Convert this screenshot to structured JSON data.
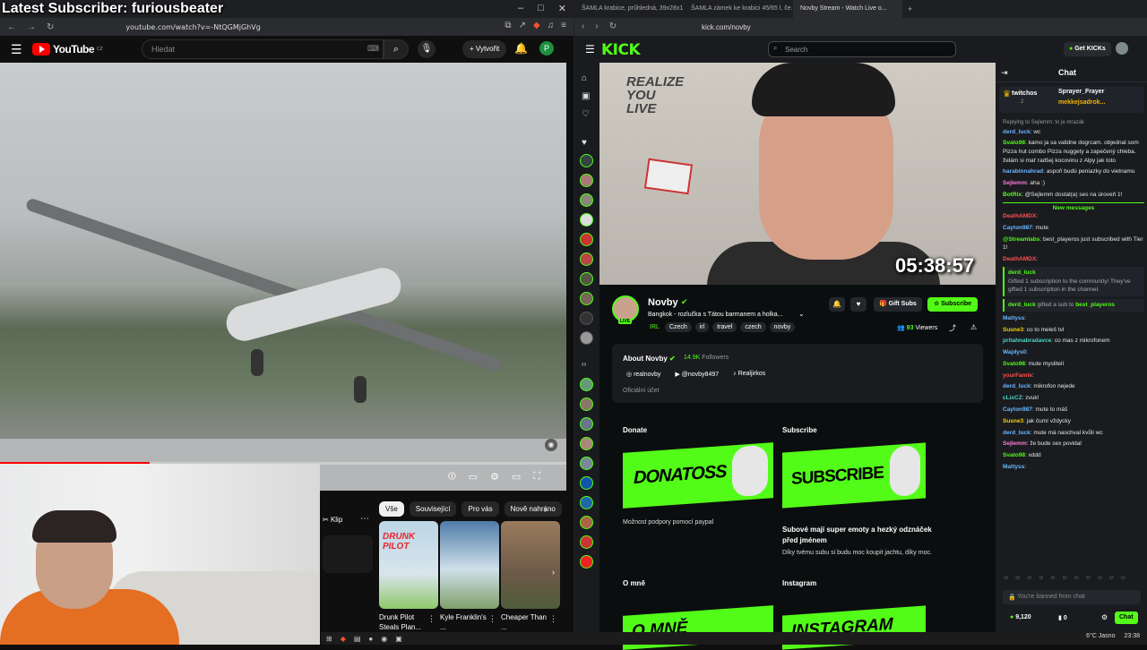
{
  "overlay": {
    "title": "Latest Subscriber: furiousbeater"
  },
  "left_browser": {
    "url": "youtube.com/watch?v=-NtQGMjGhVg",
    "youtube": {
      "logo_text": "YouTube",
      "country": "CZ",
      "search_placeholder": "Hledat",
      "create_label": "Vytvořit",
      "avatar_letter": "P",
      "clip_label": "Klip",
      "chips": [
        "Vše",
        "Související",
        "Pro vás",
        "Nově nahráno"
      ],
      "progress_fraction": 0.265,
      "videos": [
        {
          "title": "Drunk Pilot Steals Plan...",
          "thumb_text": "DRUNK PILOT"
        },
        {
          "title": "Kyle Franklin's ...",
          "thumb_text": ""
        },
        {
          "title": "Cheaper Than ...",
          "thumb_text": ""
        }
      ]
    }
  },
  "right_browser": {
    "tabs": [
      "ŠAMLA krabice, průhledná, 39x28x1...",
      "ŠAMLA zámek ke krabici 45/65 l, če...",
      "Novby Stream - Watch Live o..."
    ],
    "url": "kick.com/novby",
    "kick": {
      "logo": "KICK",
      "search_placeholder": "Search",
      "get_kicks": "Get KICKs",
      "timer": "05:38:57",
      "wall_text": "REALIZE\nYOU\nLIVE",
      "channel": {
        "name": "Novby",
        "live_badge": "LIVE",
        "title": "Bangkok - rozlučka s Tátou barmanem a holka...",
        "category": "IRL",
        "tags": [
          "Czech",
          "irl",
          "travel",
          "czech",
          "novby"
        ],
        "gift_subs": "Gift Subs",
        "subscribe": "Subscribe",
        "viewers_count": "93",
        "viewers_label": "Viewers"
      },
      "about": {
        "title": "About Novby",
        "followers_count": "14.9K",
        "followers_label": "Followers",
        "socials": [
          "realnovby",
          "@novby8497",
          "Realjirkos"
        ],
        "official": "Oficiální účet"
      },
      "panels": {
        "donate_title": "Donate",
        "donate_banner": "DONATOSS",
        "donate_desc": "Možnost podpory pomocí paypal",
        "subscribe_title": "Subscribe",
        "subscribe_banner": "SUBSCRIBE",
        "subscribe_desc1": "Subové mají super emoty a hezký odznáček před jménem",
        "subscribe_desc2": "Díky tvému subu si budu moc koupit jachtu, díky moc.",
        "omne_title": "O mně",
        "omne_banner": "O MNĚ",
        "instagram_title": "Instagram",
        "instagram_banner": "INSTAGRAM"
      },
      "chat": {
        "title": "Chat",
        "pinned_left": "twitchos",
        "pinned_num": "2",
        "pinned_r1": "Sprayer_Frayer",
        "pinned_r2": "mekkejsadrok...",
        "reply_note": "Replying to Sejlemm: to je mrazák",
        "new_messages": "New messages",
        "input_placeholder": "You're banned from chat",
        "kicks_balance": "9,120",
        "points": "0",
        "send": "Chat",
        "messages": [
          {
            "user": "derd_luck",
            "text": "wc",
            "color": "blue"
          },
          {
            "user": "Svato98",
            "text": "kamo ja sa validne dogrcam. objednal som Pizza hut combo Pizza nuggety a zapečený chleba. želám si mať radšej kocovinu z Alpy jak toto",
            "color": "green"
          },
          {
            "user": "harabinnahrad",
            "text": "aspoň budú peniazky do vietnamu",
            "color": "blue"
          },
          {
            "user": "Sejlemm",
            "text": "aha :)",
            "color": "pink"
          },
          {
            "user": "BotRix",
            "text": "@Sejlemm dostal(a) ses na úroveň 1!",
            "color": "green"
          }
        ],
        "messages_after": [
          {
            "user": "DeathAMDX",
            "text": "",
            "color": "red"
          },
          {
            "user": "Cayton987",
            "text": "mute",
            "color": "blue"
          },
          {
            "user": "@Streamlabs",
            "text": "best_playeros just subscribed with Tier 1!",
            "color": "green"
          },
          {
            "user": "DeathAMDX",
            "text": "",
            "color": "red"
          }
        ],
        "sys1_user": "derd_luck",
        "sys1_text": "Gifted 1 subscription to the community! They've gifted 1 subscription in the channel.",
        "sys2_user": "derd_luck",
        "sys2_text": "gifted a sub to",
        "sys2_target": "best_playeros",
        "messages_end": [
          {
            "user": "Mattyss",
            "text": "",
            "color": "blue"
          },
          {
            "user": "Susne3",
            "text": "co to meleš tvl",
            "color": "yellow"
          },
          {
            "user": "pritahnabradavce",
            "text": "co mas z mikrofonem",
            "color": "teal"
          },
          {
            "user": "Wajdys0",
            "text": "",
            "color": "blue"
          },
          {
            "user": "Svato98",
            "text": "mute myslitelí",
            "color": "green"
          },
          {
            "user": "yourFamle",
            "text": "",
            "color": "red"
          },
          {
            "user": "derd_luck",
            "text": "mikrofon nejede",
            "color": "blue"
          },
          {
            "user": "cLixCZ",
            "text": "zvuk!",
            "color": "teal"
          },
          {
            "user": "Cayton987",
            "text": "mute to máš",
            "color": "blue"
          },
          {
            "user": "Susne3",
            "text": "jak čumí vždycky",
            "color": "yellow"
          },
          {
            "user": "derd_luck",
            "text": "mute má naschval kvůli wc",
            "color": "blue"
          },
          {
            "user": "Sejlemm",
            "text": "že bude sex povidal",
            "color": "pink"
          },
          {
            "user": "Svato98",
            "text": "xddd",
            "color": "green"
          },
          {
            "user": "Mattyss",
            "text": "",
            "color": "blue"
          }
        ]
      }
    }
  },
  "taskbar": {
    "weather": "6°C Jasno",
    "time": "23:38"
  }
}
